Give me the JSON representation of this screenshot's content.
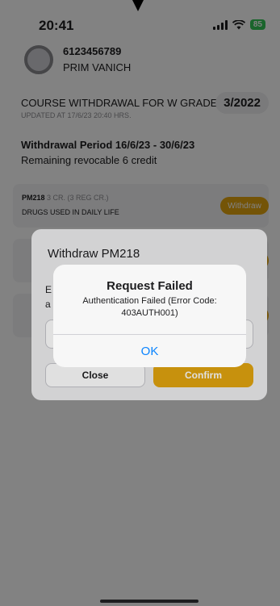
{
  "status_bar": {
    "time": "20:41",
    "battery": "85"
  },
  "profile": {
    "student_id": "6123456789",
    "name": "PRIM VANICH"
  },
  "course_withdrawal": {
    "title": "COURSE WITHDRAWAL FOR W GRADE",
    "term": "3/2022",
    "updated": "UPDATED AT 17/6/23 20:40 HRS.",
    "period": "Withdrawal Period 16/6/23 - 30/6/23",
    "remaining": "Remaining revocable 6 credit"
  },
  "courses": [
    {
      "code": "PM218",
      "credits": "3 CR. (3 REG CR.)",
      "name": "DRUGS USED IN DAILY LIFE",
      "button": "Withdraw"
    }
  ],
  "withdraw_dialog": {
    "title": "Withdraw PM218",
    "hint_partial": "E",
    "hint_partial_2": "a",
    "close_label": "Close",
    "confirm_label": "Confirm"
  },
  "alert": {
    "title": "Request Failed",
    "message": "Authentication Failed (Error Code: 403AUTH001)",
    "ok_label": "OK"
  },
  "colors": {
    "accent": "#e3a50f",
    "link": "#0a84ff",
    "battery": "#34c759"
  }
}
